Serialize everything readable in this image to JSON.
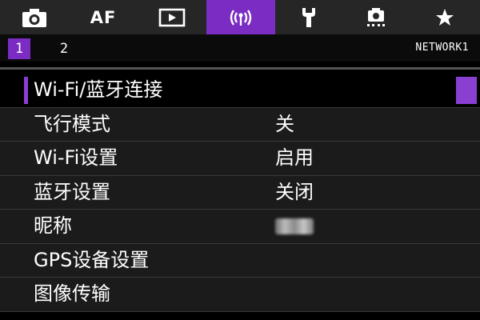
{
  "tabs": [
    {
      "icon": "camera-icon",
      "label": "",
      "active": false
    },
    {
      "icon": "af-icon",
      "label": "AF",
      "active": false
    },
    {
      "icon": "playback-icon",
      "label": "",
      "active": false
    },
    {
      "icon": "wireless-icon",
      "label": "",
      "active": true
    },
    {
      "icon": "wrench-icon",
      "label": "",
      "active": false
    },
    {
      "icon": "custom-mode-icon",
      "label": "",
      "active": false
    },
    {
      "icon": "star-icon",
      "label": "",
      "active": false
    }
  ],
  "subtabs": [
    {
      "label": "1",
      "active": true
    },
    {
      "label": "2",
      "active": false
    }
  ],
  "page_label": "NETWORK1",
  "menu": [
    {
      "label": "Wi-Fi/蓝牙连接",
      "value": ""
    },
    {
      "label": "飞行模式",
      "value": "关"
    },
    {
      "label": "Wi-Fi设置",
      "value": "启用"
    },
    {
      "label": "蓝牙设置",
      "value": "关闭"
    },
    {
      "label": "昵称",
      "value": ""
    },
    {
      "label": "GPS设备设置",
      "value": ""
    },
    {
      "label": "图像传输",
      "value": ""
    }
  ],
  "colors": {
    "accent": "#7b2cc3",
    "tabbar": "#262626",
    "row_bg": "#1b1b1b",
    "text": "#ffffff"
  }
}
